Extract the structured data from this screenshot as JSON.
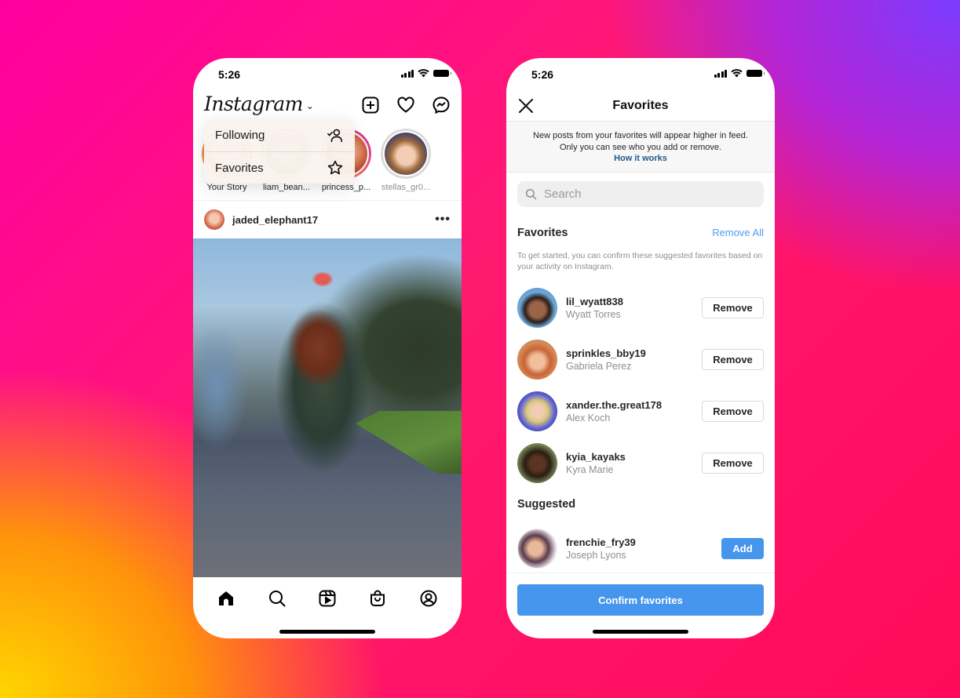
{
  "left_phone": {
    "status_time": "5:26",
    "app_logo": "Instagram",
    "header_icons": [
      "new-post-icon",
      "heart-icon",
      "messenger-icon"
    ],
    "feed_menu": {
      "items": [
        {
          "label": "Following",
          "icon": "following-person-icon"
        },
        {
          "label": "Favorites",
          "icon": "star-icon"
        }
      ]
    },
    "stories": [
      {
        "label": "Your Story",
        "seen": false
      },
      {
        "label": "liam_bean...",
        "seen": false
      },
      {
        "label": "princess_p...",
        "seen": false
      },
      {
        "label": "stellas_gr0...",
        "seen": true
      }
    ],
    "post": {
      "username": "jaded_elephant17",
      "more_label": "•••"
    },
    "tab_bar": [
      "home-icon",
      "search-icon",
      "reels-icon",
      "shop-icon",
      "profile-icon"
    ]
  },
  "right_phone": {
    "status_time": "5:26",
    "title": "Favorites",
    "info_line1": "New posts from your favorites will appear higher in feed.",
    "info_line2": "Only you can see who you add or remove.",
    "info_link": "How it works",
    "search_placeholder": "Search",
    "favorites_title": "Favorites",
    "remove_all_label": "Remove All",
    "favorites_hint": "To get started, you can confirm these suggested favorites based on your activity on Instagram.",
    "favorites": [
      {
        "username": "lil_wyatt838",
        "name": "Wyatt Torres",
        "action": "Remove"
      },
      {
        "username": "sprinkles_bby19",
        "name": "Gabriela Perez",
        "action": "Remove"
      },
      {
        "username": "xander.the.great178",
        "name": "Alex Koch",
        "action": "Remove"
      },
      {
        "username": "kyia_kayaks",
        "name": "Kyra Marie",
        "action": "Remove"
      }
    ],
    "suggested_title": "Suggested",
    "suggested": [
      {
        "username": "frenchie_fry39",
        "name": "Joseph Lyons",
        "action": "Add"
      }
    ],
    "confirm_label": "Confirm favorites"
  },
  "colors": {
    "accent_blue": "#4596ec",
    "link_blue": "#4a9ef0",
    "info_link": "#1e5a8c"
  }
}
